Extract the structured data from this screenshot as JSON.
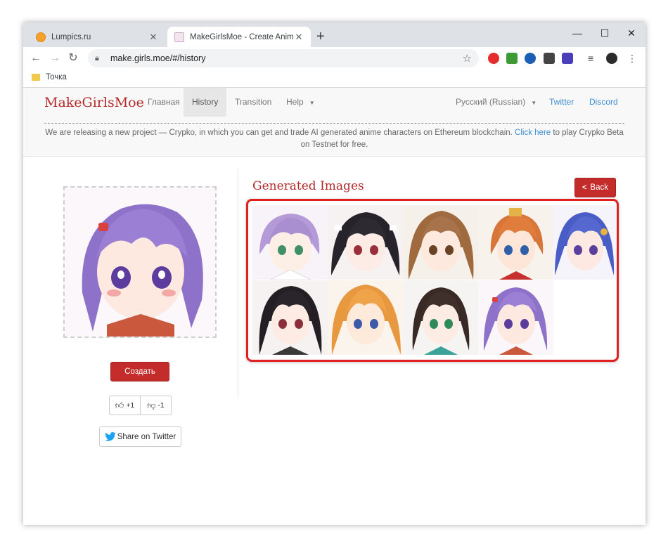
{
  "browser": {
    "tabs": [
      {
        "title": "Lumpics.ru",
        "active": false
      },
      {
        "title": "MakeGirlsMoe - Create Anime Ch",
        "active": true
      }
    ],
    "new_tab": "+",
    "window_controls": {
      "minimize": "—",
      "maximize": "☐",
      "close": "✕"
    },
    "url": "make.girls.moe/#/history",
    "bookmark": "Точка"
  },
  "site": {
    "brand": "MakeGirlsMoe",
    "nav": {
      "home": "Главная",
      "history": "History",
      "transition": "Transition",
      "help": "Help",
      "language": "Русский (Russian)",
      "twitter": "Twitter",
      "discord": "Discord"
    },
    "announcement": {
      "before": "We are releasing a new project — Crypko, in which you can get and trade AI generated anime characters on Ethereum blockchain. ",
      "link": "Click here",
      "after": " to play Crypko Beta on Testnet for free."
    }
  },
  "left_panel": {
    "create_label": "Создать",
    "upvote_label": "+1",
    "downvote_label": "-1",
    "share_label": "Share on Twitter"
  },
  "right_panel": {
    "title": "Generated Images",
    "back_label": "Back",
    "image_count": 9
  },
  "colors": {
    "brand_red": "#b52a2a",
    "button_red": "#c42b2b",
    "highlight_red": "#e02020",
    "link_blue": "#3e8ed4"
  }
}
